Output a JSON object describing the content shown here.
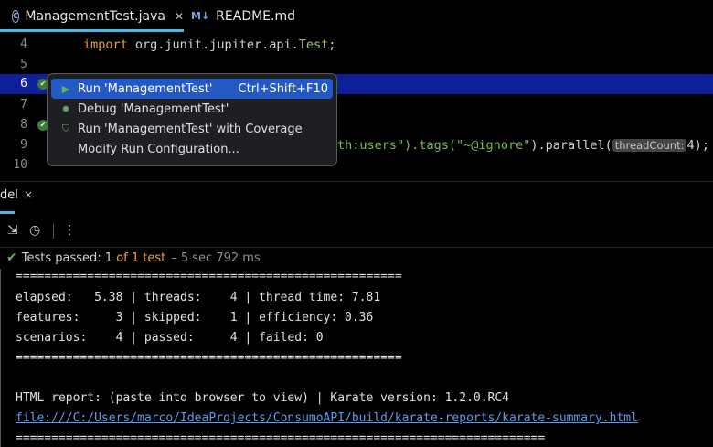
{
  "tabs": [
    {
      "label": "ManagementTest.java",
      "icon": "java-class-icon",
      "active": true
    },
    {
      "label": "README.md",
      "icon": "markdown-icon",
      "active": false
    }
  ],
  "editor": {
    "lines": [
      {
        "num": "4",
        "code": [
          "import",
          " org.junit.jupiter.api.",
          "Test",
          ";"
        ]
      },
      {
        "num": "5",
        "code": []
      },
      {
        "num": "6",
        "code": []
      },
      {
        "num": "7",
        "code": []
      },
      {
        "num": "8",
        "code": []
      },
      {
        "num": "9",
        "code_fragment": "th:users\").tags(\"~@ignore\").parallel(",
        "hint": "threadCount:",
        "tail": "4);"
      },
      {
        "num": "10",
        "code": []
      }
    ],
    "line4": {
      "kw": "import",
      "pkg": " org.junit.jupiter.api.",
      "cls": "Test",
      "semi": ";"
    },
    "line9": {
      "pre": "th:users\").tags(",
      "str": "\"~@ignore\"",
      "mid": ").parallel(",
      "hint": "threadCount:",
      "tail": "4);"
    }
  },
  "popup": {
    "items": [
      {
        "label": "Run 'ManagementTest'",
        "shortcut": "Ctrl+Shift+F10",
        "icon": "run-icon"
      },
      {
        "label": "Debug 'ManagementTest'",
        "shortcut": "",
        "icon": "debug-icon"
      },
      {
        "label": "Run 'ManagementTest' with Coverage",
        "shortcut": "",
        "icon": "coverage-icon"
      },
      {
        "label": "Modify Run Configuration...",
        "shortcut": "",
        "icon": ""
      }
    ]
  },
  "toolwindow": {
    "title": "del",
    "close": "×"
  },
  "status": {
    "prefix": "Tests passed:",
    "passed": "1",
    "of_text": "of 1 test",
    "time": "– 5 sec 792 ms"
  },
  "console": {
    "rule": "======================================================",
    "rule_long": "==========================================================================",
    "lines": [
      "elapsed:   5.38 | threads:    4 | thread time: 7.81",
      "features:     3 | skipped:    1 | efficiency: 0.36",
      "scenarios:    4 | passed:     4 | failed: 0"
    ],
    "report_line": "HTML report: (paste into browser to view) | Karate version: 1.2.0.RC4",
    "report_link": "file:///C:/Users/marco/IdeaProjects/ConsumoAPI/build/karate-reports/karate-summary.html"
  }
}
